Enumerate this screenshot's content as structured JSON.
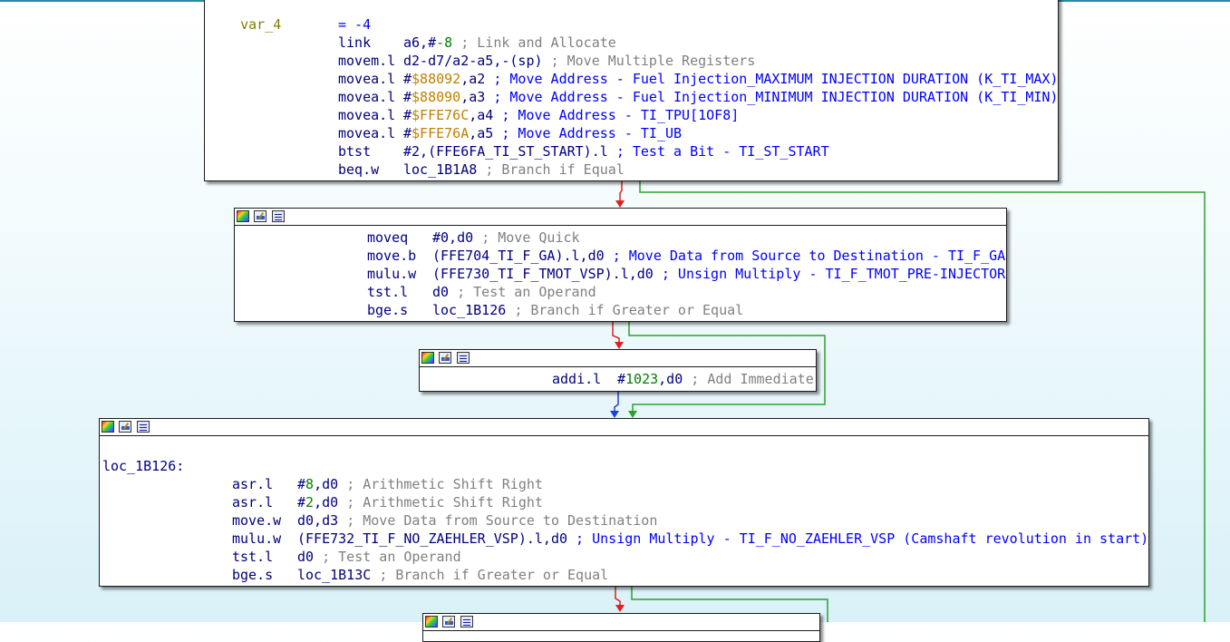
{
  "window": {
    "title": ""
  },
  "blocks": {
    "b1": {
      "var_line": {
        "name": "var_4",
        "eq": "= -4"
      },
      "lines": [
        {
          "mn": "link",
          "op": "a6,#",
          "opn": "-8",
          "rest": "",
          "cm": "; Link and Allocate"
        },
        {
          "mn": "movem.l",
          "op": "d2-d7/a2-a5,-(sp)",
          "cm": "; Move Multiple Registers"
        },
        {
          "mn": "movea.l",
          "pre": "#",
          "hex": "$88092",
          "post": ",a2",
          "cm": "; Move Address - Fuel Injection_MAXIMUM INJECTION DURATION (K_TI_MAX)"
        },
        {
          "mn": "movea.l",
          "pre": "#",
          "hex": "$88090",
          "post": ",a3",
          "cm": "; Move Address - Fuel Injection_MINIMUM INJECTION DURATION (K_TI_MIN)"
        },
        {
          "mn": "movea.l",
          "pre": "#",
          "hex": "$FFE76C",
          "post": ",a4",
          "cm": "; Move Address - TI_TPU[1OF8]"
        },
        {
          "mn": "movea.l",
          "pre": "#",
          "hex": "$FFE76A",
          "post": ",a5",
          "cm": "; Move Address - TI_UB"
        },
        {
          "mn": "btst",
          "op": "#2,(FFE6FA_TI_ST_START).l",
          "cm": "; Test a Bit - TI_ST_START"
        },
        {
          "mn": "beq.w",
          "op": "loc_1B1A8",
          "cm": "; Branch if Equal"
        }
      ]
    },
    "b2": {
      "lines": [
        {
          "mn": "moveq",
          "op": "#0,d0",
          "cm": "; Move Quick"
        },
        {
          "mn": "move.b",
          "op": "(FFE704_TI_F_GA).l,d0",
          "cm": "; Move Data from Source to Destination - TI_F_GA"
        },
        {
          "mn": "mulu.w",
          "op": "(FFE730_TI_F_TMOT_VSP).l,d0",
          "cm": "; Unsign Multiply - TI_F_TMOT_PRE-INJECTOR"
        },
        {
          "mn": "tst.l",
          "op": "d0",
          "cm": "; Test an Operand"
        },
        {
          "mn": "bge.s",
          "op": "loc_1B126",
          "cm": "; Branch if Greater or Equal"
        }
      ]
    },
    "b3": {
      "lines": [
        {
          "mn": "addi.l",
          "pre": "#",
          "num": "1023",
          "post": ",d0",
          "cm": "; Add Immediate"
        }
      ]
    },
    "b4": {
      "label": "loc_1B126:",
      "lines": [
        {
          "mn": "asr.l",
          "pre": "#",
          "num": "8",
          "post": ",d0",
          "cm": "; Arithmetic Shift Right"
        },
        {
          "mn": "asr.l",
          "pre": "#",
          "num": "2",
          "post": ",d0",
          "cm": "; Arithmetic Shift Right"
        },
        {
          "mn": "move.w",
          "op": "d0,d3",
          "cm": "; Move Data from Source to Destination"
        },
        {
          "mn": "mulu.w",
          "op": "(FFE732_TI_F_NO_ZAEHLER_VSP).l,d0",
          "cm": "; Unsign Multiply - TI_F_NO_ZAEHLER_VSP (Camshaft revolution in start)"
        },
        {
          "mn": "tst.l",
          "op": "d0",
          "cm": "; Test an Operand"
        },
        {
          "mn": "bge.s",
          "op": "loc_1B13C",
          "cm": "; Branch if Greater or Equal"
        }
      ]
    }
  },
  "colors": {
    "edge_true": "#2ca02c",
    "edge_false": "#e02020",
    "edge_uncond": "#2040e0",
    "code": "#000080",
    "comment": "#808080",
    "number": "#008000",
    "hexaddr": "#c08000",
    "block_header_icons": [
      "graph-colors-icon",
      "edit-icon",
      "list-icon"
    ]
  }
}
